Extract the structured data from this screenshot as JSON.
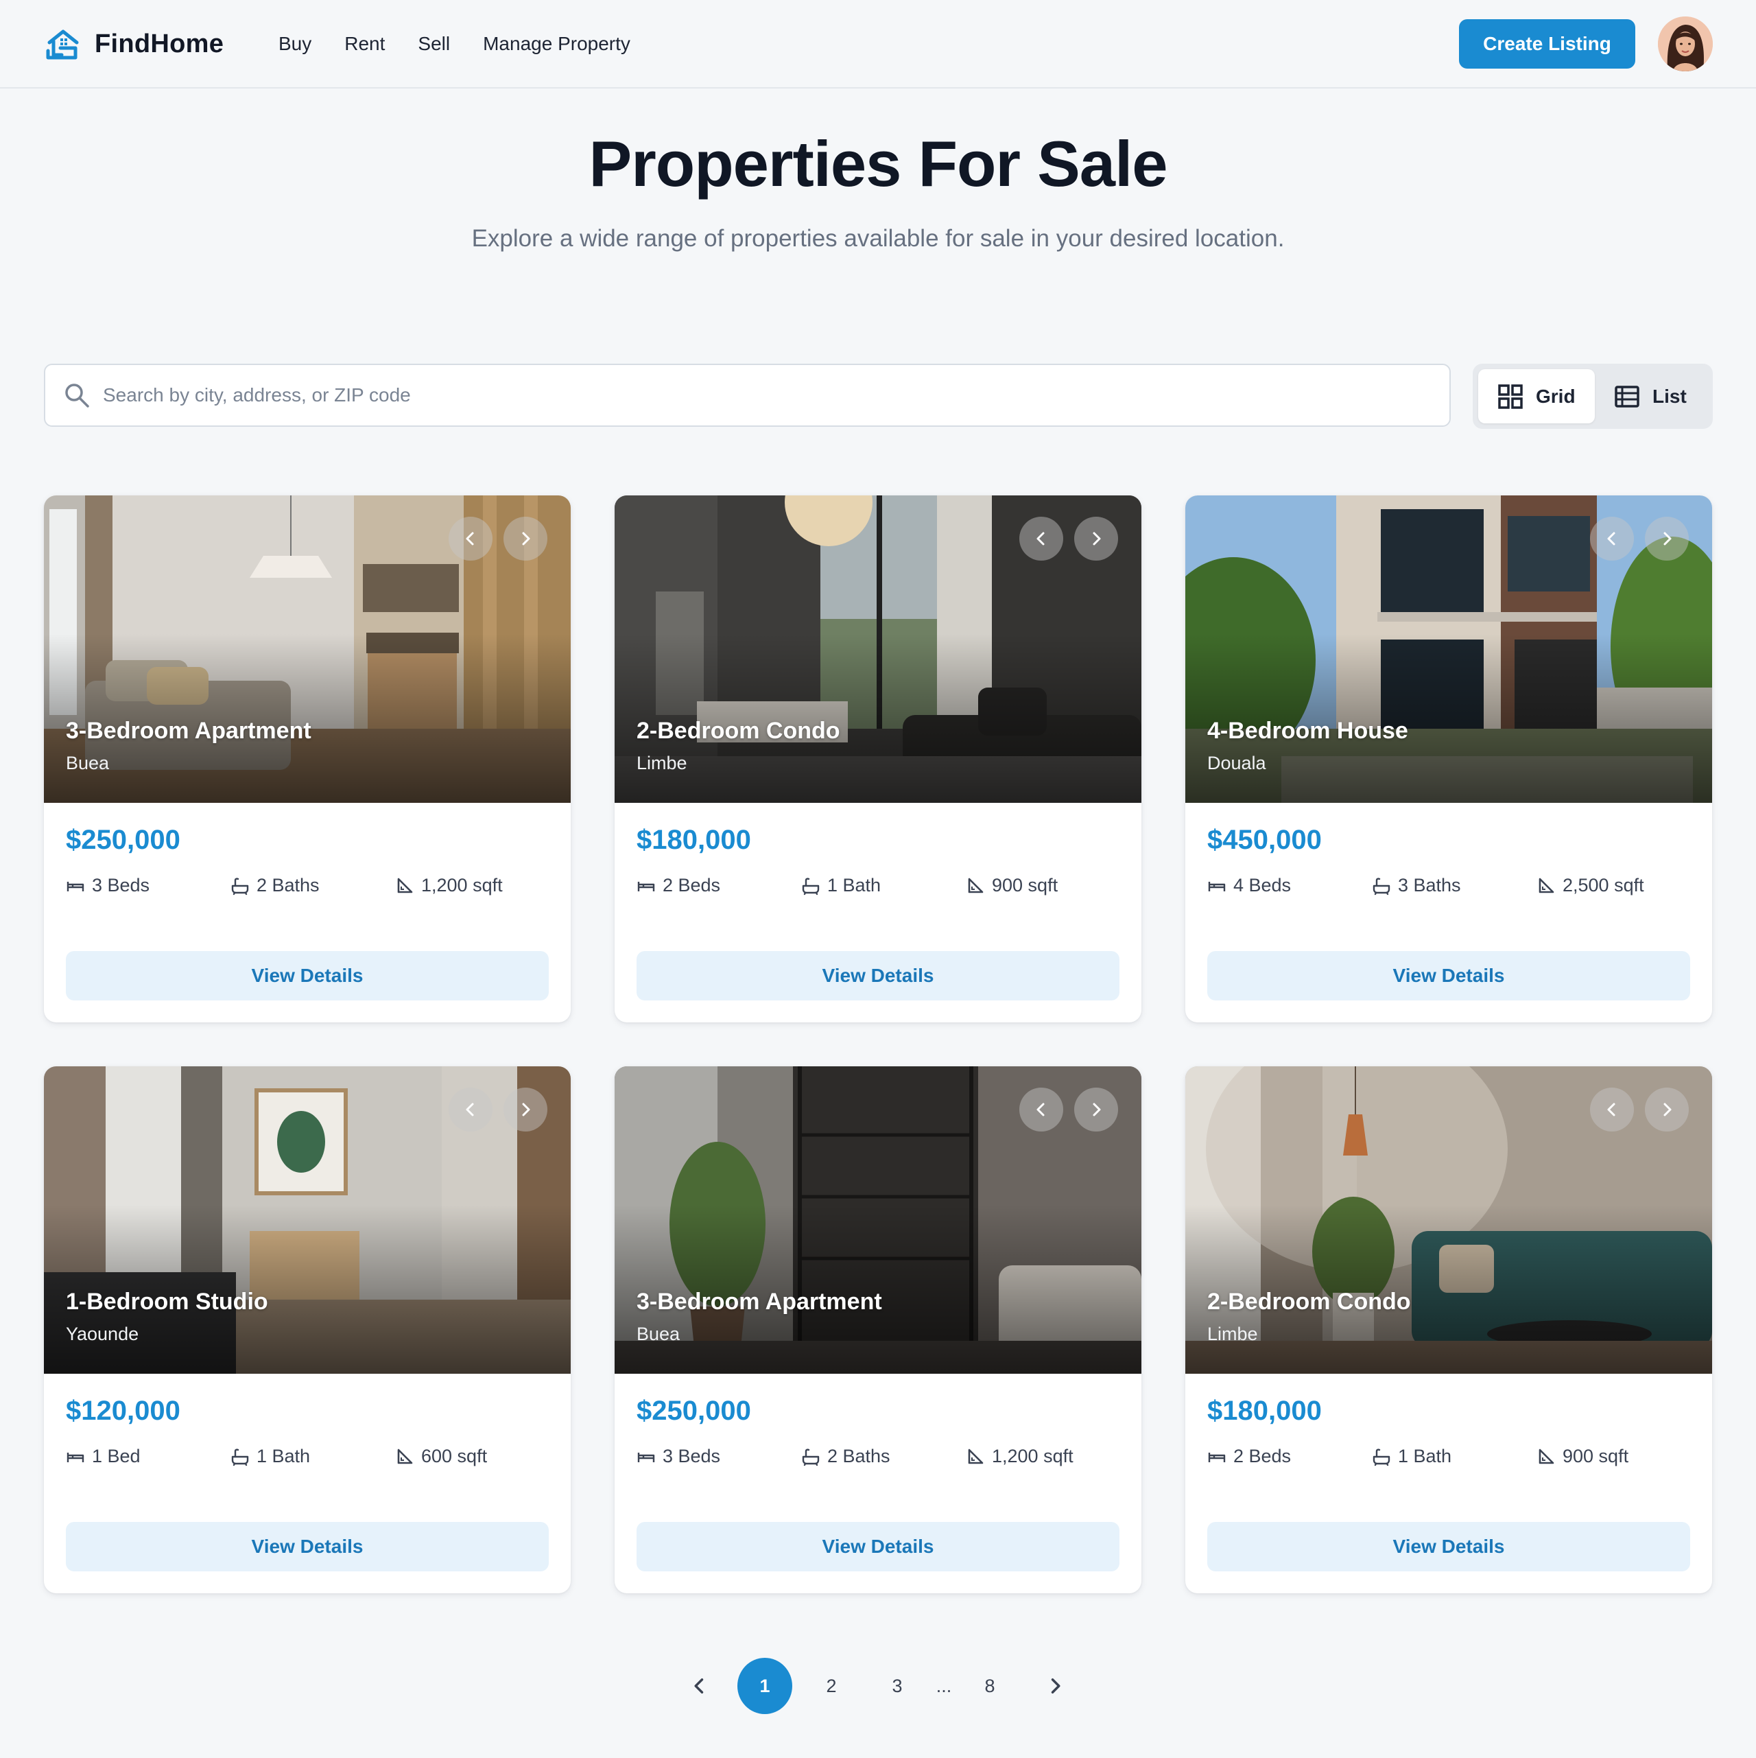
{
  "header": {
    "brand": "FindHome",
    "nav": [
      "Buy",
      "Rent",
      "Sell",
      "Manage Property"
    ],
    "cta_label": "Create Listing"
  },
  "hero": {
    "title": "Properties For Sale",
    "subtitle": "Explore a wide range of properties available for sale in your desired location."
  },
  "search": {
    "placeholder": "Search by city, address, or ZIP code",
    "value": ""
  },
  "view_toggle": {
    "grid_label": "Grid",
    "list_label": "List",
    "selected": "Grid"
  },
  "listings": [
    {
      "title": "3-Bedroom Apartment",
      "location": "Buea",
      "price": "$250,000",
      "beds": "3 Beds",
      "baths": "2 Baths",
      "area": "1,200 sqft",
      "button": "View Details"
    },
    {
      "title": "2-Bedroom Condo",
      "location": "Limbe",
      "price": "$180,000",
      "beds": "2 Beds",
      "baths": "1 Bath",
      "area": "900 sqft",
      "button": "View Details"
    },
    {
      "title": "4-Bedroom House",
      "location": "Douala",
      "price": "$450,000",
      "beds": "4 Beds",
      "baths": "3 Baths",
      "area": "2,500 sqft",
      "button": "View Details"
    },
    {
      "title": "1-Bedroom Studio",
      "location": "Yaounde",
      "price": "$120,000",
      "beds": "1 Bed",
      "baths": "1 Bath",
      "area": "600 sqft",
      "button": "View Details"
    },
    {
      "title": "3-Bedroom Apartment",
      "location": "Buea",
      "price": "$250,000",
      "beds": "3 Beds",
      "baths": "2 Baths",
      "area": "1,200 sqft",
      "button": "View Details"
    },
    {
      "title": "2-Bedroom Condo",
      "location": "Limbe",
      "price": "$180,000",
      "beds": "2 Beds",
      "baths": "1 Bath",
      "area": "900 sqft",
      "button": "View Details"
    }
  ],
  "pagination": {
    "pages": [
      "1",
      "2",
      "3",
      "...",
      "8"
    ],
    "current": "1"
  },
  "colors": {
    "accent": "#1a8bd1",
    "button_soft": "#e6f2fb",
    "background": "#f5f7f9"
  },
  "icons": [
    "house-logo-icon",
    "search-icon",
    "grid-icon",
    "list-icon",
    "chevron-left-icon",
    "chevron-right-icon",
    "bed-icon",
    "bath-icon",
    "area-icon"
  ]
}
